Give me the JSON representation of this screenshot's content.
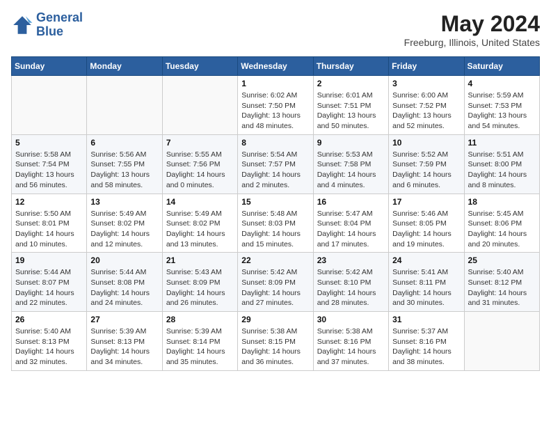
{
  "header": {
    "logo_line1": "General",
    "logo_line2": "Blue",
    "month_title": "May 2024",
    "location": "Freeburg, Illinois, United States"
  },
  "weekdays": [
    "Sunday",
    "Monday",
    "Tuesday",
    "Wednesday",
    "Thursday",
    "Friday",
    "Saturday"
  ],
  "weeks": [
    [
      {
        "day": "",
        "info": ""
      },
      {
        "day": "",
        "info": ""
      },
      {
        "day": "",
        "info": ""
      },
      {
        "day": "1",
        "info": "Sunrise: 6:02 AM\nSunset: 7:50 PM\nDaylight: 13 hours\nand 48 minutes."
      },
      {
        "day": "2",
        "info": "Sunrise: 6:01 AM\nSunset: 7:51 PM\nDaylight: 13 hours\nand 50 minutes."
      },
      {
        "day": "3",
        "info": "Sunrise: 6:00 AM\nSunset: 7:52 PM\nDaylight: 13 hours\nand 52 minutes."
      },
      {
        "day": "4",
        "info": "Sunrise: 5:59 AM\nSunset: 7:53 PM\nDaylight: 13 hours\nand 54 minutes."
      }
    ],
    [
      {
        "day": "5",
        "info": "Sunrise: 5:58 AM\nSunset: 7:54 PM\nDaylight: 13 hours\nand 56 minutes."
      },
      {
        "day": "6",
        "info": "Sunrise: 5:56 AM\nSunset: 7:55 PM\nDaylight: 13 hours\nand 58 minutes."
      },
      {
        "day": "7",
        "info": "Sunrise: 5:55 AM\nSunset: 7:56 PM\nDaylight: 14 hours\nand 0 minutes."
      },
      {
        "day": "8",
        "info": "Sunrise: 5:54 AM\nSunset: 7:57 PM\nDaylight: 14 hours\nand 2 minutes."
      },
      {
        "day": "9",
        "info": "Sunrise: 5:53 AM\nSunset: 7:58 PM\nDaylight: 14 hours\nand 4 minutes."
      },
      {
        "day": "10",
        "info": "Sunrise: 5:52 AM\nSunset: 7:59 PM\nDaylight: 14 hours\nand 6 minutes."
      },
      {
        "day": "11",
        "info": "Sunrise: 5:51 AM\nSunset: 8:00 PM\nDaylight: 14 hours\nand 8 minutes."
      }
    ],
    [
      {
        "day": "12",
        "info": "Sunrise: 5:50 AM\nSunset: 8:01 PM\nDaylight: 14 hours\nand 10 minutes."
      },
      {
        "day": "13",
        "info": "Sunrise: 5:49 AM\nSunset: 8:02 PM\nDaylight: 14 hours\nand 12 minutes."
      },
      {
        "day": "14",
        "info": "Sunrise: 5:49 AM\nSunset: 8:02 PM\nDaylight: 14 hours\nand 13 minutes."
      },
      {
        "day": "15",
        "info": "Sunrise: 5:48 AM\nSunset: 8:03 PM\nDaylight: 14 hours\nand 15 minutes."
      },
      {
        "day": "16",
        "info": "Sunrise: 5:47 AM\nSunset: 8:04 PM\nDaylight: 14 hours\nand 17 minutes."
      },
      {
        "day": "17",
        "info": "Sunrise: 5:46 AM\nSunset: 8:05 PM\nDaylight: 14 hours\nand 19 minutes."
      },
      {
        "day": "18",
        "info": "Sunrise: 5:45 AM\nSunset: 8:06 PM\nDaylight: 14 hours\nand 20 minutes."
      }
    ],
    [
      {
        "day": "19",
        "info": "Sunrise: 5:44 AM\nSunset: 8:07 PM\nDaylight: 14 hours\nand 22 minutes."
      },
      {
        "day": "20",
        "info": "Sunrise: 5:44 AM\nSunset: 8:08 PM\nDaylight: 14 hours\nand 24 minutes."
      },
      {
        "day": "21",
        "info": "Sunrise: 5:43 AM\nSunset: 8:09 PM\nDaylight: 14 hours\nand 26 minutes."
      },
      {
        "day": "22",
        "info": "Sunrise: 5:42 AM\nSunset: 8:09 PM\nDaylight: 14 hours\nand 27 minutes."
      },
      {
        "day": "23",
        "info": "Sunrise: 5:42 AM\nSunset: 8:10 PM\nDaylight: 14 hours\nand 28 minutes."
      },
      {
        "day": "24",
        "info": "Sunrise: 5:41 AM\nSunset: 8:11 PM\nDaylight: 14 hours\nand 30 minutes."
      },
      {
        "day": "25",
        "info": "Sunrise: 5:40 AM\nSunset: 8:12 PM\nDaylight: 14 hours\nand 31 minutes."
      }
    ],
    [
      {
        "day": "26",
        "info": "Sunrise: 5:40 AM\nSunset: 8:13 PM\nDaylight: 14 hours\nand 32 minutes."
      },
      {
        "day": "27",
        "info": "Sunrise: 5:39 AM\nSunset: 8:13 PM\nDaylight: 14 hours\nand 34 minutes."
      },
      {
        "day": "28",
        "info": "Sunrise: 5:39 AM\nSunset: 8:14 PM\nDaylight: 14 hours\nand 35 minutes."
      },
      {
        "day": "29",
        "info": "Sunrise: 5:38 AM\nSunset: 8:15 PM\nDaylight: 14 hours\nand 36 minutes."
      },
      {
        "day": "30",
        "info": "Sunrise: 5:38 AM\nSunset: 8:16 PM\nDaylight: 14 hours\nand 37 minutes."
      },
      {
        "day": "31",
        "info": "Sunrise: 5:37 AM\nSunset: 8:16 PM\nDaylight: 14 hours\nand 38 minutes."
      },
      {
        "day": "",
        "info": ""
      }
    ]
  ]
}
